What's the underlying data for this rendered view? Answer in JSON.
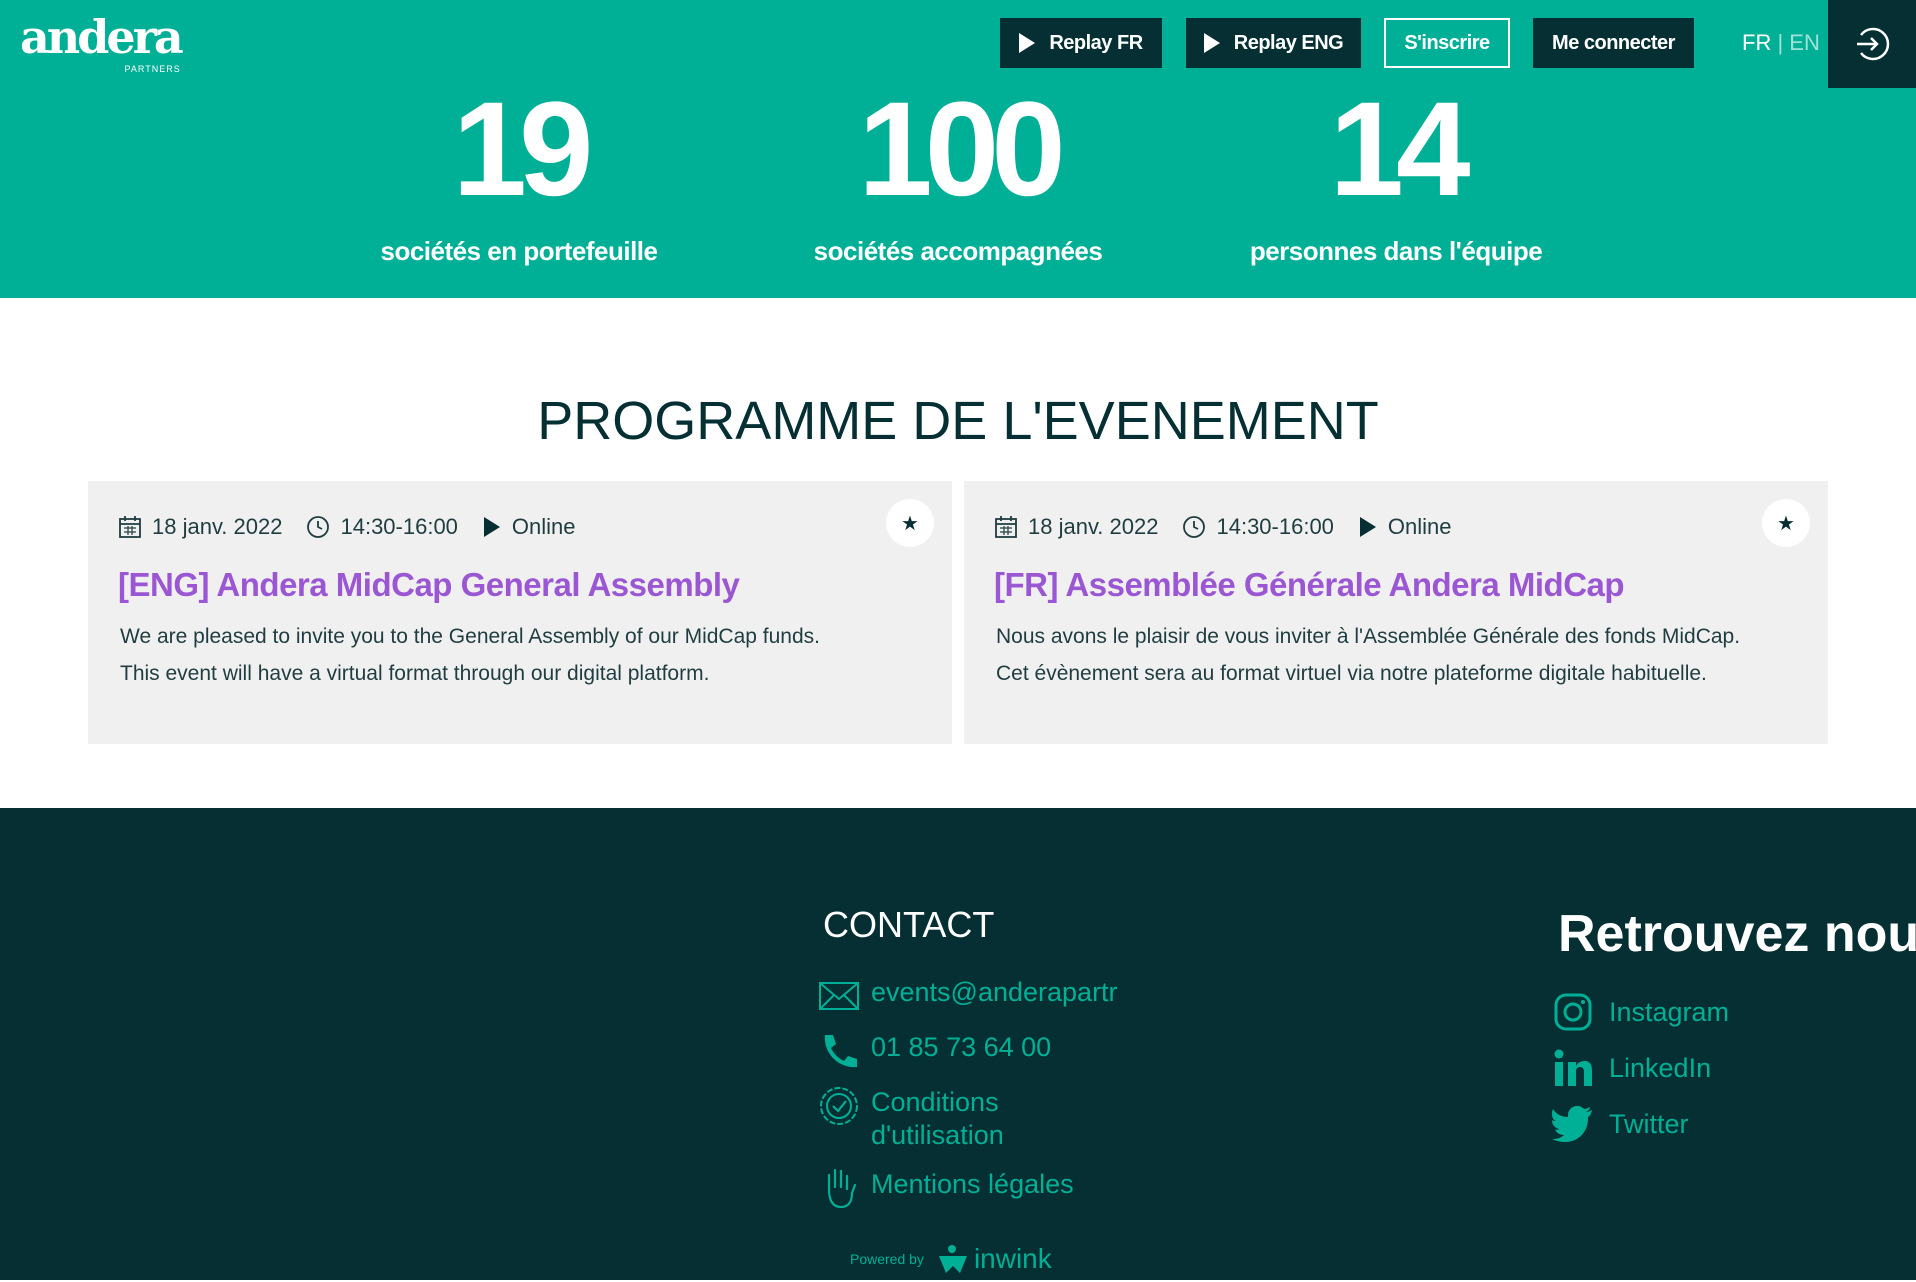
{
  "brand": {
    "logo_text": "andera",
    "logo_sub": "PARTNERS"
  },
  "nav": {
    "replay_fr": "Replay FR",
    "replay_eng": "Replay ENG",
    "register": "S'inscrire",
    "login": "Me connecter",
    "lang_fr": "FR",
    "lang_sep": "|",
    "lang_en": "EN"
  },
  "stats": [
    {
      "number": "19",
      "label": "sociétés en portefeuille"
    },
    {
      "number": "100",
      "label": "sociétés accompagnées"
    },
    {
      "number": "14",
      "label": "personnes dans l'équipe"
    }
  ],
  "programme": {
    "title": "PROGRAMME DE L'EVENEMENT",
    "cards": [
      {
        "date": "18 janv. 2022",
        "time": "14:30-16:00",
        "mode": "Online",
        "title": "[ENG] Andera MidCap General Assembly",
        "desc_1": "We are pleased to invite you to the General Assembly of our MidCap funds.",
        "desc_2": "This event will have a virtual format through our digital platform."
      },
      {
        "date": "18 janv. 2022",
        "time": "14:30-16:00",
        "mode": "Online",
        "title": "[FR] Assemblée Générale Andera MidCap",
        "desc_1": "Nous avons le plaisir de vous inviter à l'Assemblée Générale des fonds MidCap.",
        "desc_2": "Cet évènement sera au format virtuel via notre plateforme digitale habituelle."
      }
    ]
  },
  "footer": {
    "contact_title": "CONTACT",
    "email": "events@anderapartr",
    "phone": "01 85 73 64 00",
    "terms": "Conditions d'utilisation",
    "legal": "Mentions légales",
    "social_title": "Retrouvez nous",
    "instagram": "Instagram",
    "linkedin": "LinkedIn",
    "twitter": "Twitter",
    "powered_by": "Powered by",
    "powered_brand": "inwink"
  },
  "colors": {
    "primary": "#00b096",
    "dark": "#052f33",
    "accent": "#9b57d3",
    "card_bg": "#f0f0f0"
  }
}
